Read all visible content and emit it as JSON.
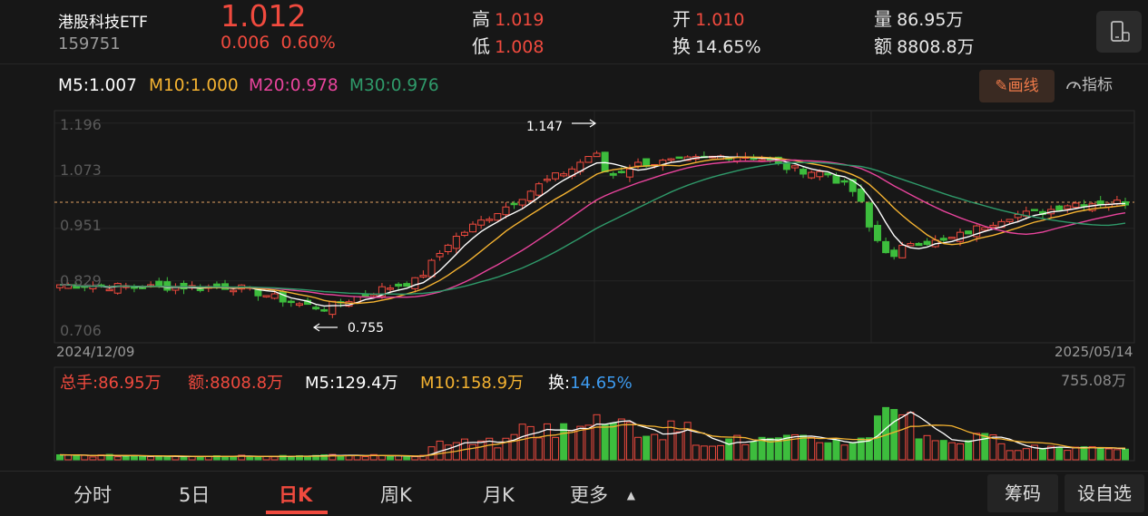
{
  "quote": {
    "name": "港股科技ETF",
    "code": "159751",
    "price": "1.012",
    "change": "0.006",
    "change_pct": "0.60%",
    "high_label": "高",
    "high": "1.019",
    "low_label": "低",
    "low": "1.008",
    "open_label": "开",
    "open": "1.010",
    "turnover_label": "换",
    "turnover": "14.65%",
    "volume_label": "量",
    "volume": "86.95万",
    "amount_label": "额",
    "amount": "8808.8万"
  },
  "ma": {
    "m5": "M5:1.007",
    "m10": "M10:1.000",
    "m20": "M20:0.978",
    "m30": "M30:0.976"
  },
  "colors": {
    "up": "#f04a3e",
    "down": "#3dbd3d",
    "m5": "#ffffff",
    "m10": "#f5b331",
    "m20": "#e8449c",
    "m30": "#2f9a6a"
  },
  "toolbar": {
    "draw_label": "画线",
    "indicator_label": "指标",
    "draw_icon": "pencil-icon",
    "indicator_icon": "gauge-icon",
    "device_icon": "phone-landscape-icon"
  },
  "price_chart": {
    "y_ticks": [
      "1.196",
      "1.073",
      "0.951",
      "0.829",
      "0.706"
    ],
    "start_date": "2024/12/09",
    "end_date": "2025/05/14",
    "high_marker": "1.147",
    "low_marker": "0.755",
    "current_price_line": 1.012
  },
  "volume_chart": {
    "total_label": "总手:86.95万",
    "amount_label": "额:8808.8万",
    "m5_label": "M5:129.4万",
    "m10_label": "M10:158.9万",
    "turnover_prefix": "换:",
    "turnover_value": "14.65%",
    "max_label": "755.08万"
  },
  "tabs": [
    "分时",
    "5日",
    "日K",
    "周K",
    "月K",
    "更多"
  ],
  "active_tab": "日K",
  "side_buttons": [
    "筹码",
    "设自选"
  ]
}
